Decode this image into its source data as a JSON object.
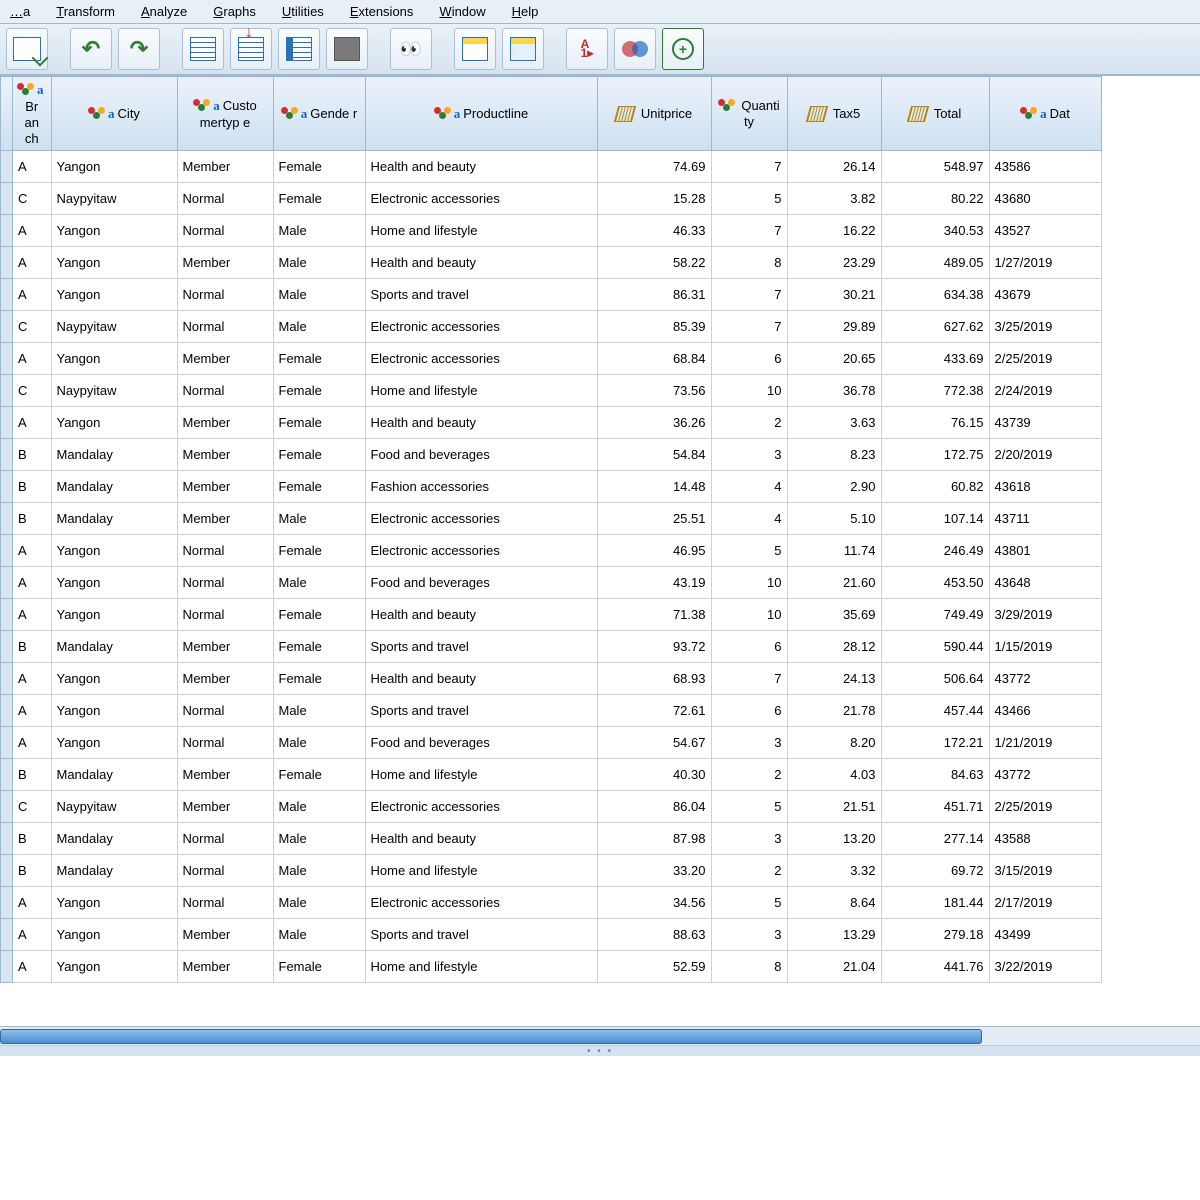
{
  "menu": [
    "…a",
    "Transform",
    "Analyze",
    "Graphs",
    "Utilities",
    "Extensions",
    "Window",
    "Help"
  ],
  "menu_accel": [
    0,
    0,
    0,
    0,
    0,
    0,
    0,
    0
  ],
  "columns": [
    {
      "name": "Branch",
      "label": "Br an ch",
      "type": "nom-a",
      "align": "txt",
      "width": "c-br"
    },
    {
      "name": "City",
      "label": "City",
      "type": "nom-a",
      "align": "txt",
      "width": "c-city"
    },
    {
      "name": "Customertype",
      "label": "Custo mertyp e",
      "type": "nom-a",
      "align": "txt",
      "width": "c-cust"
    },
    {
      "name": "Gender",
      "label": "Gende r",
      "type": "nom-a",
      "align": "txt",
      "width": "c-gen"
    },
    {
      "name": "Productline",
      "label": "Productline",
      "type": "nom-a",
      "align": "txt",
      "width": "c-prod"
    },
    {
      "name": "Unitprice",
      "label": "Unitprice",
      "type": "scale",
      "align": "num",
      "width": "c-unit"
    },
    {
      "name": "Quantity",
      "label": "Quanti ty",
      "type": "nom",
      "align": "num",
      "width": "c-qty"
    },
    {
      "name": "Tax5",
      "label": "Tax5",
      "type": "scale",
      "align": "num",
      "width": "c-tax"
    },
    {
      "name": "Total",
      "label": "Total",
      "type": "scale",
      "align": "num",
      "width": "c-total"
    },
    {
      "name": "Date",
      "label": "Dat",
      "type": "nom-a",
      "align": "txt",
      "width": "c-date"
    }
  ],
  "rows": [
    [
      "A",
      "Yangon",
      "Member",
      "Female",
      "Health and beauty",
      "74.69",
      "7",
      "26.14",
      "548.97",
      "43586"
    ],
    [
      "C",
      "Naypyitaw",
      "Normal",
      "Female",
      "Electronic accessories",
      "15.28",
      "5",
      "3.82",
      "80.22",
      "43680"
    ],
    [
      "A",
      "Yangon",
      "Normal",
      "Male",
      "Home and lifestyle",
      "46.33",
      "7",
      "16.22",
      "340.53",
      "43527"
    ],
    [
      "A",
      "Yangon",
      "Member",
      "Male",
      "Health and beauty",
      "58.22",
      "8",
      "23.29",
      "489.05",
      "1/27/2019"
    ],
    [
      "A",
      "Yangon",
      "Normal",
      "Male",
      "Sports and travel",
      "86.31",
      "7",
      "30.21",
      "634.38",
      "43679"
    ],
    [
      "C",
      "Naypyitaw",
      "Normal",
      "Male",
      "Electronic accessories",
      "85.39",
      "7",
      "29.89",
      "627.62",
      "3/25/2019"
    ],
    [
      "A",
      "Yangon",
      "Member",
      "Female",
      "Electronic accessories",
      "68.84",
      "6",
      "20.65",
      "433.69",
      "2/25/2019"
    ],
    [
      "C",
      "Naypyitaw",
      "Normal",
      "Female",
      "Home and lifestyle",
      "73.56",
      "10",
      "36.78",
      "772.38",
      "2/24/2019"
    ],
    [
      "A",
      "Yangon",
      "Member",
      "Female",
      "Health and beauty",
      "36.26",
      "2",
      "3.63",
      "76.15",
      "43739"
    ],
    [
      "B",
      "Mandalay",
      "Member",
      "Female",
      "Food and beverages",
      "54.84",
      "3",
      "8.23",
      "172.75",
      "2/20/2019"
    ],
    [
      "B",
      "Mandalay",
      "Member",
      "Female",
      "Fashion accessories",
      "14.48",
      "4",
      "2.90",
      "60.82",
      "43618"
    ],
    [
      "B",
      "Mandalay",
      "Member",
      "Male",
      "Electronic accessories",
      "25.51",
      "4",
      "5.10",
      "107.14",
      "43711"
    ],
    [
      "A",
      "Yangon",
      "Normal",
      "Female",
      "Electronic accessories",
      "46.95",
      "5",
      "11.74",
      "246.49",
      "43801"
    ],
    [
      "A",
      "Yangon",
      "Normal",
      "Male",
      "Food and beverages",
      "43.19",
      "10",
      "21.60",
      "453.50",
      "43648"
    ],
    [
      "A",
      "Yangon",
      "Normal",
      "Female",
      "Health and beauty",
      "71.38",
      "10",
      "35.69",
      "749.49",
      "3/29/2019"
    ],
    [
      "B",
      "Mandalay",
      "Member",
      "Female",
      "Sports and travel",
      "93.72",
      "6",
      "28.12",
      "590.44",
      "1/15/2019"
    ],
    [
      "A",
      "Yangon",
      "Member",
      "Female",
      "Health and beauty",
      "68.93",
      "7",
      "24.13",
      "506.64",
      "43772"
    ],
    [
      "A",
      "Yangon",
      "Normal",
      "Male",
      "Sports and travel",
      "72.61",
      "6",
      "21.78",
      "457.44",
      "43466"
    ],
    [
      "A",
      "Yangon",
      "Normal",
      "Male",
      "Food and beverages",
      "54.67",
      "3",
      "8.20",
      "172.21",
      "1/21/2019"
    ],
    [
      "B",
      "Mandalay",
      "Member",
      "Female",
      "Home and lifestyle",
      "40.30",
      "2",
      "4.03",
      "84.63",
      "43772"
    ],
    [
      "C",
      "Naypyitaw",
      "Member",
      "Male",
      "Electronic accessories",
      "86.04",
      "5",
      "21.51",
      "451.71",
      "2/25/2019"
    ],
    [
      "B",
      "Mandalay",
      "Normal",
      "Male",
      "Health and beauty",
      "87.98",
      "3",
      "13.20",
      "277.14",
      "43588"
    ],
    [
      "B",
      "Mandalay",
      "Normal",
      "Male",
      "Home and lifestyle",
      "33.20",
      "2",
      "3.32",
      "69.72",
      "3/15/2019"
    ],
    [
      "A",
      "Yangon",
      "Normal",
      "Male",
      "Electronic accessories",
      "34.56",
      "5",
      "8.64",
      "181.44",
      "2/17/2019"
    ],
    [
      "A",
      "Yangon",
      "Member",
      "Male",
      "Sports and travel",
      "88.63",
      "3",
      "13.29",
      "279.18",
      "43499"
    ],
    [
      "A",
      "Yangon",
      "Member",
      "Female",
      "Home and lifestyle",
      "52.59",
      "8",
      "21.04",
      "441.76",
      "3/22/2019"
    ]
  ]
}
